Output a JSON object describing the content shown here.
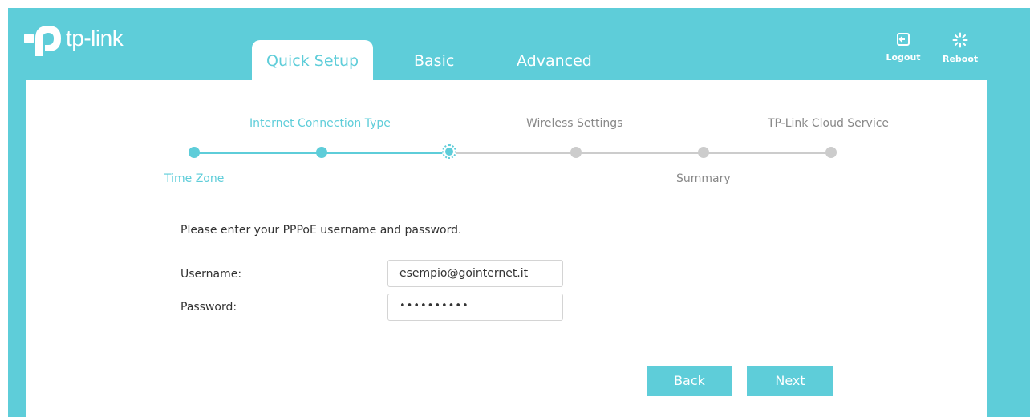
{
  "header": {
    "logo_text": "tp-link",
    "tabs": [
      {
        "label": "Quick Setup",
        "active": true
      },
      {
        "label": "Basic",
        "active": false
      },
      {
        "label": "Advanced",
        "active": false
      }
    ],
    "actions": {
      "logout": {
        "label": "Logout",
        "icon": "logout-icon"
      },
      "reboot": {
        "label": "Reboot",
        "icon": "reboot-icon"
      }
    }
  },
  "stepper": {
    "steps": [
      {
        "label": "Time Zone",
        "state": "done"
      },
      {
        "label": "Internet Connection Type",
        "state": "done"
      },
      {
        "label": "",
        "state": "current"
      },
      {
        "label": "Wireless Settings",
        "state": "todo"
      },
      {
        "label": "Summary",
        "state": "todo"
      },
      {
        "label": "TP-Link Cloud Service",
        "state": "todo"
      }
    ]
  },
  "form": {
    "instruction": "Please enter your PPPoE username and password.",
    "username": {
      "label": "Username:",
      "value": "esempio@gointernet.it"
    },
    "password": {
      "label": "Password:",
      "value": "••••••••••"
    }
  },
  "buttons": {
    "back": "Back",
    "next": "Next"
  },
  "colors": {
    "accent": "#5ecdd9",
    "inactive": "#cccccc",
    "text": "#333333"
  }
}
